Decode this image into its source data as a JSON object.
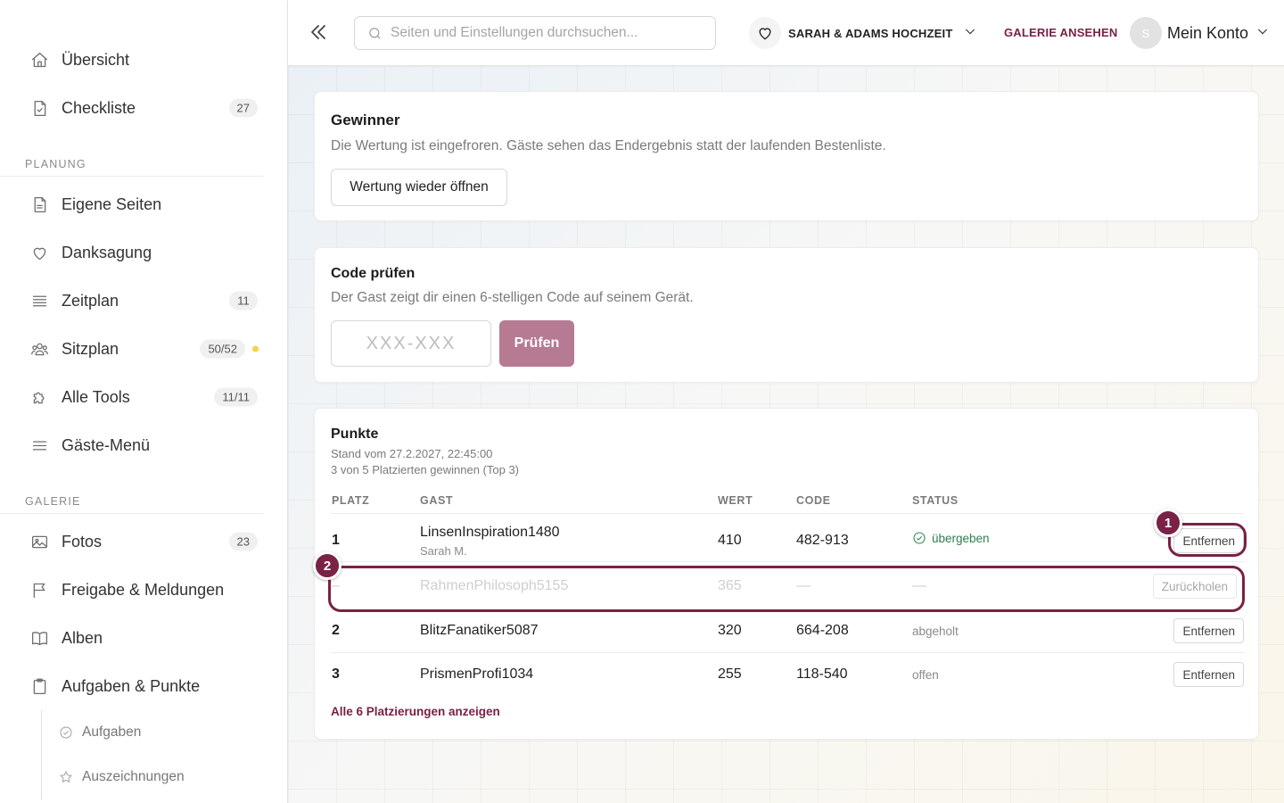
{
  "sidebar": {
    "top_items": [
      {
        "label": "Übersicht",
        "badge": ""
      },
      {
        "label": "Checkliste",
        "badge": "27"
      }
    ],
    "planning_title": "PLANUNG",
    "planning_items": [
      {
        "label": "Eigene Seiten",
        "badge": ""
      },
      {
        "label": "Danksagung",
        "badge": ""
      },
      {
        "label": "Zeitplan",
        "badge": "11"
      },
      {
        "label": "Sitzplan",
        "badge": "50/52"
      },
      {
        "label": "Alle Tools",
        "badge": "11/11"
      },
      {
        "label": "Gäste-Menü",
        "badge": ""
      }
    ],
    "gallery_title": "GALERIE",
    "gallery_items": [
      {
        "label": "Fotos",
        "badge": "23"
      },
      {
        "label": "Freigabe & Meldungen",
        "badge": ""
      },
      {
        "label": "Alben",
        "badge": ""
      },
      {
        "label": "Aufgaben & Punkte",
        "badge": ""
      }
    ],
    "sub_items": [
      {
        "label": "Aufgaben"
      },
      {
        "label": "Auszeichnungen"
      }
    ],
    "status_dot_color": "#f4d540"
  },
  "topbar": {
    "search_placeholder": "Seiten und Einstellungen durchsuchen...",
    "event_name": "SARAH & ADAMS HOCHZEIT",
    "gallery_link": "GALERIE ANSEHEN",
    "avatar_initial": "S",
    "account_label": "Mein Konto"
  },
  "winner_card": {
    "title": "Gewinner",
    "description": "Die Wertung ist eingefroren. Gäste sehen das Endergebnis statt der laufenden Bestenliste.",
    "button": "Wertung wieder öffnen"
  },
  "code_card": {
    "title": "Code prüfen",
    "description": "Der Gast zeigt dir einen 6-stelligen Code auf seinem Gerät.",
    "placeholder": "XXX-XXX",
    "button": "Prüfen"
  },
  "points_card": {
    "title": "Punkte",
    "timestamp": "Stand vom 27.2.2027, 22:45:00",
    "summary": "3 von 5 Platzierten gewinnen (Top 3)",
    "columns": {
      "rank": "PLATZ",
      "guest": "GAST",
      "value": "WERT",
      "code": "CODE",
      "status": "STATUS"
    },
    "rows": [
      {
        "rank": "1",
        "guest": "LinsenInspiration1480",
        "guest_sub": "Sarah M.",
        "value": "410",
        "code": "482-913",
        "status": "übergeben",
        "action": "Entfernen"
      },
      {
        "rank": "–",
        "guest": "RahmenPhilosoph5155",
        "guest_sub": "",
        "value": "365",
        "code": "—",
        "status": "—",
        "action": "Zurückholen"
      },
      {
        "rank": "2",
        "guest": "BlitzFanatiker5087",
        "guest_sub": "",
        "value": "320",
        "code": "664-208",
        "status": "abgeholt",
        "action": "Entfernen"
      },
      {
        "rank": "3",
        "guest": "PrismenProfi1034",
        "guest_sub": "",
        "value": "255",
        "code": "118-540",
        "status": "offen",
        "action": "Entfernen"
      }
    ],
    "show_all": "Alle 6 Platzierungen anzeigen"
  },
  "annotations": {
    "marker_1": "1",
    "marker_2": "2",
    "accent_color": "#7a2146"
  }
}
